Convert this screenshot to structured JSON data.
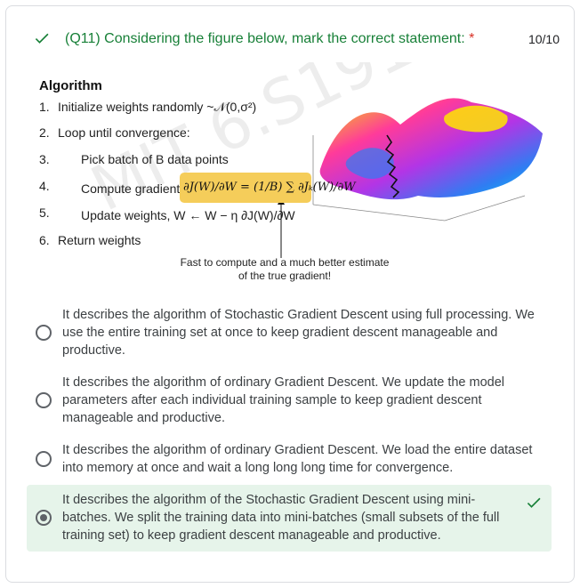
{
  "question": {
    "title": "(Q11) Considering the figure below, mark the correct statement:",
    "required_mark": "*",
    "score": "10/10"
  },
  "figure": {
    "algorithm_title": "Algorithm",
    "steps": [
      {
        "num": "1.",
        "text": "Initialize weights randomly ~𝒩(0,σ²)"
      },
      {
        "num": "2.",
        "text": "Loop until convergence:"
      },
      {
        "num": "3.",
        "text": "Pick batch of B data points"
      },
      {
        "num": "4.",
        "text": "Compute gradient,"
      },
      {
        "num": "5.",
        "text": "Update weights, W ← W − η ∂J(W)/∂W"
      },
      {
        "num": "6.",
        "text": "Return weights"
      }
    ],
    "formula": "∂J(W)/∂W = (1/B) ∑ ∂Jₖ(W)/∂W",
    "callout": "Fast to compute and a much better estimate of the true gradient!",
    "watermark": "MIT 6.S191"
  },
  "options": [
    {
      "text": "It describes the algorithm of Stochastic Gradient Descent using full processing. We use the entire training set at once to keep gradient descent manageable and productive.",
      "selected": false
    },
    {
      "text": "It describes the algorithm of ordinary Gradient Descent. We update the model parameters after each individual training sample to keep gradient descent manageable and productive.",
      "selected": false
    },
    {
      "text": "It describes the algorithm of ordinary Gradient Descent. We load the entire dataset into memory at once and wait a long long long time for convergence.",
      "selected": false
    },
    {
      "text": "It describes the algorithm of the Stochastic Gradient Descent using mini-batches. We split the training data into mini-batches (small subsets of the full training set) to keep gradient descent manageable and productive.",
      "selected": true
    }
  ],
  "colors": {
    "correct": "#188038",
    "correct_bg": "#e6f4ea",
    "required": "#d93025",
    "formula_highlight": "#f5cd5a"
  }
}
